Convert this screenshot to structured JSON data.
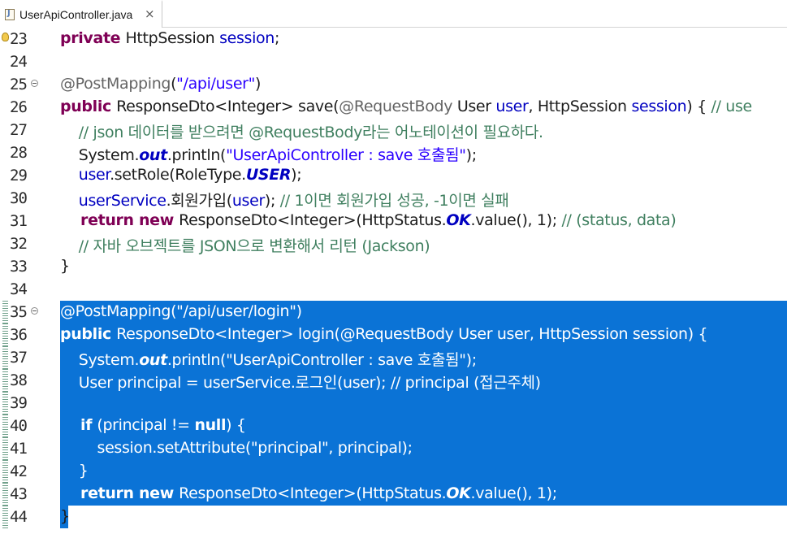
{
  "tab": {
    "filename": "UserApiController.java",
    "close_glyph": "×"
  },
  "selection_color": "#0b73d6",
  "lines": [
    {
      "num": "23",
      "tokens": [
        [
          "k",
          "    private "
        ],
        [
          "",
          "HttpSession "
        ],
        [
          "f",
          "session"
        ],
        [
          "",
          ";"
        ]
      ]
    },
    {
      "num": "24",
      "tokens": []
    },
    {
      "num": "25",
      "tokens": [
        [
          "a",
          "    @PostMapping"
        ],
        [
          "",
          "("
        ],
        [
          "s",
          "\"/api/user\""
        ],
        [
          "",
          ")"
        ]
      ]
    },
    {
      "num": "26",
      "tokens": [
        [
          "k",
          "    public "
        ],
        [
          "",
          "ResponseDto<Integer> save("
        ],
        [
          "a",
          "@RequestBody "
        ],
        [
          "",
          "User "
        ],
        [
          "f",
          "user"
        ],
        [
          "",
          ", HttpSession "
        ],
        [
          "f",
          "session"
        ],
        [
          "",
          ") { "
        ],
        [
          "c",
          "// use"
        ]
      ]
    },
    {
      "num": "27",
      "tokens": [
        [
          "c",
          "        // json 데이터를 받으려면 @RequestBody라는 어노테이션이 필요하다."
        ]
      ]
    },
    {
      "num": "28",
      "tokens": [
        [
          "",
          "        System."
        ],
        [
          "fi",
          "out"
        ],
        [
          "",
          ".println("
        ],
        [
          "s",
          "\"UserApiController : save 호출됨\""
        ],
        [
          "",
          ");"
        ]
      ]
    },
    {
      "num": "29",
      "tokens": [
        [
          "f",
          "        user"
        ],
        [
          "",
          ".setRole(RoleType."
        ],
        [
          "fi",
          "USER"
        ],
        [
          "",
          ");"
        ]
      ]
    },
    {
      "num": "30",
      "tokens": [
        [
          "f",
          "        userService"
        ],
        [
          "",
          ".회원가입("
        ],
        [
          "f",
          "user"
        ],
        [
          "",
          "); "
        ],
        [
          "c",
          "// 1이면 회원가입 성공, -1이면 실패"
        ]
      ]
    },
    {
      "num": "31",
      "tokens": [
        [
          "k",
          "        return new "
        ],
        [
          "",
          "ResponseDto<Integer>(HttpStatus."
        ],
        [
          "fi",
          "OK"
        ],
        [
          "",
          ".value(), 1); "
        ],
        [
          "c",
          "// (status, data)"
        ]
      ]
    },
    {
      "num": "32",
      "tokens": [
        [
          "c",
          "        // 자바 오브젝트를 JSON으로 변환해서 리턴 (Jackson)"
        ]
      ]
    },
    {
      "num": "33",
      "tokens": [
        [
          "",
          "    }"
        ]
      ]
    },
    {
      "num": "34",
      "tokens": []
    },
    {
      "num": "35",
      "tokens": [
        [
          "a",
          "    @PostMapping"
        ],
        [
          "",
          "("
        ],
        [
          "s",
          "\"/api/user/login\""
        ],
        [
          "",
          ")"
        ]
      ]
    },
    {
      "num": "36",
      "tokens": [
        [
          "k",
          "    public "
        ],
        [
          "",
          "ResponseDto<Integer> login("
        ],
        [
          "a",
          "@RequestBody "
        ],
        [
          "",
          "User user, HttpSession session) {"
        ]
      ]
    },
    {
      "num": "37",
      "tokens": [
        [
          "",
          "        System."
        ],
        [
          "fi",
          "out"
        ],
        [
          "",
          ".println("
        ],
        [
          "s",
          "\"UserApiController : save 호출됨\""
        ],
        [
          "",
          ");"
        ]
      ]
    },
    {
      "num": "38",
      "tokens": [
        [
          "",
          "        User principal = userService.로그인(user); "
        ],
        [
          "c",
          "// principal (접근주체)"
        ]
      ]
    },
    {
      "num": "39",
      "tokens": []
    },
    {
      "num": "40",
      "tokens": [
        [
          "k",
          "        if "
        ],
        [
          "",
          "(principal != "
        ],
        [
          "k",
          "null"
        ],
        [
          "",
          ") {"
        ]
      ]
    },
    {
      "num": "41",
      "tokens": [
        [
          "",
          "            session.setAttribute("
        ],
        [
          "s",
          "\"principal\""
        ],
        [
          "",
          ", principal);"
        ]
      ]
    },
    {
      "num": "42",
      "tokens": [
        [
          "",
          "        }"
        ]
      ]
    },
    {
      "num": "43",
      "tokens": [
        [
          "k",
          "        return new "
        ],
        [
          "",
          "ResponseDto<Integer>(HttpStatus."
        ],
        [
          "fi",
          "OK"
        ],
        [
          "",
          ".value(), 1);"
        ]
      ]
    },
    {
      "num": "44",
      "tokens": [
        [
          "",
          "    }"
        ]
      ]
    }
  ],
  "fold_lines": [
    "25",
    "35"
  ],
  "warning_lines": [
    "23"
  ],
  "selected_lines": [
    "35",
    "36",
    "37",
    "38",
    "39",
    "40",
    "41",
    "42",
    "43"
  ],
  "selected_last_line": "44"
}
